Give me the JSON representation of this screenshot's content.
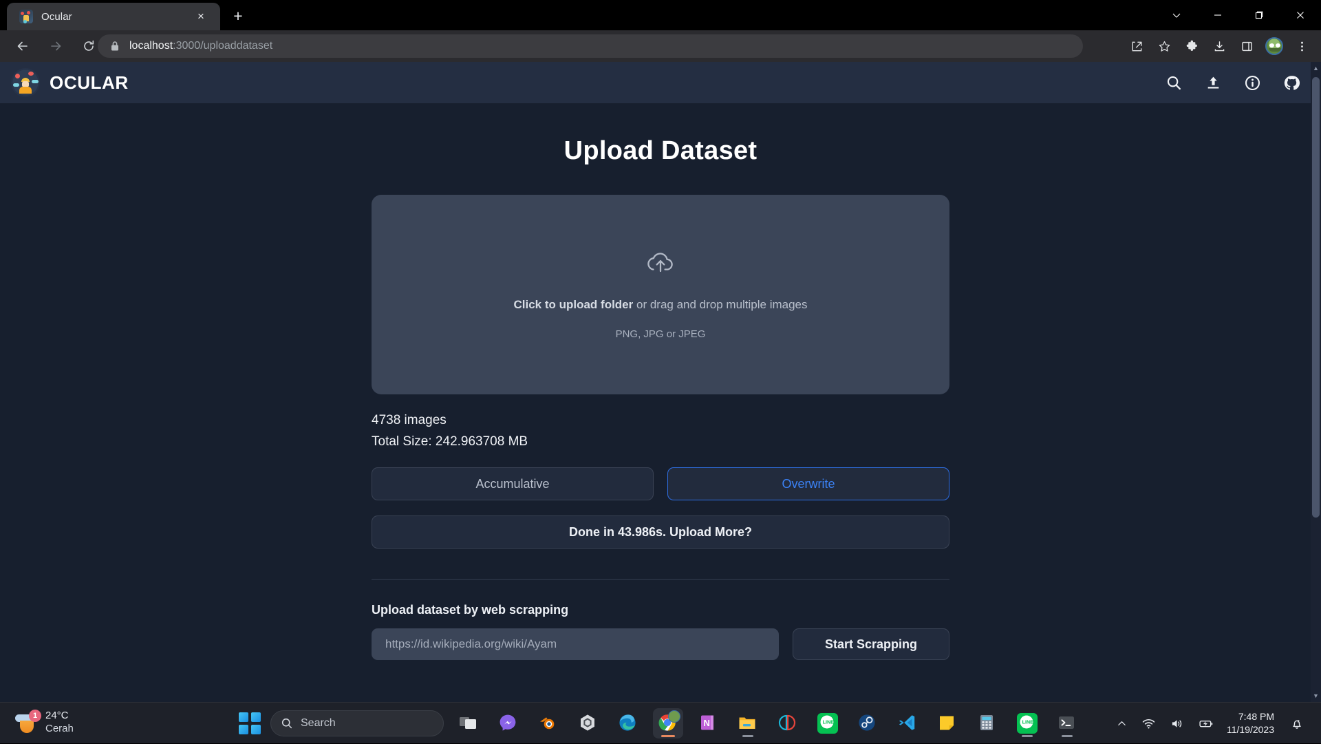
{
  "browser": {
    "tab": {
      "title": "Ocular",
      "favicon": "ocular-favicon",
      "close_label": "×"
    },
    "new_tab_label": "+",
    "window_controls": {
      "collapse": "chevron-down",
      "minimize": "minimize",
      "maximize": "restore",
      "close": "close"
    },
    "nav": {
      "back": "back-arrow",
      "forward": "forward-arrow",
      "reload": "reload"
    },
    "omnibox": {
      "lock": "lock-icon",
      "url_host": "localhost",
      "url_path": ":3000/uploaddataset",
      "url_full": "localhost:3000/uploaddataset"
    },
    "actions": [
      "share-icon",
      "bookmark-star-icon",
      "extensions-icon",
      "downloads-icon",
      "side-panel-icon",
      "profile-avatar",
      "more-menu-icon"
    ]
  },
  "app": {
    "brand": "OCULAR",
    "nav_icons": [
      "search-icon",
      "upload-icon",
      "info-icon",
      "github-icon"
    ]
  },
  "main": {
    "title": "Upload Dataset",
    "dropzone": {
      "icon": "cloud-upload-icon",
      "primary_strong": "Click to upload folder",
      "primary_rest": " or drag and drop multiple images",
      "secondary": "PNG, JPG or JPEG"
    },
    "stats": {
      "images": "4738 images",
      "total_size": "Total Size: 242.963708 MB"
    },
    "modes": [
      {
        "label": "Accumulative",
        "active": false
      },
      {
        "label": "Overwrite",
        "active": true
      }
    ],
    "done_message": "Done in 43.986s. Upload More?",
    "scraping": {
      "label": "Upload dataset by web scrapping",
      "input_value": "",
      "input_placeholder": "https://id.wikipedia.org/wiki/Ayam",
      "button": "Start Scrapping"
    }
  },
  "colors": {
    "accent_blue": "#3b82f6",
    "page_bg": "#171f2e",
    "appbar_bg": "#242e42",
    "dropzone_bg": "#3b4558",
    "button_bg": "#222b3d"
  },
  "taskbar": {
    "weather": {
      "temperature": "24°C",
      "condition": "Cerah",
      "badge": "1"
    },
    "start_label": "start-button",
    "search_placeholder": "Search",
    "apps": [
      {
        "name": "task-view",
        "running": false
      },
      {
        "name": "messenger",
        "running": false
      },
      {
        "name": "blender",
        "running": false
      },
      {
        "name": "unity",
        "running": false
      },
      {
        "name": "microsoft-edge",
        "running": false
      },
      {
        "name": "google-chrome",
        "running": true
      },
      {
        "name": "onenote",
        "running": false
      },
      {
        "name": "file-explorer",
        "running": true
      },
      {
        "name": "figma",
        "running": false
      },
      {
        "name": "line",
        "running": false
      },
      {
        "name": "steam",
        "running": false
      },
      {
        "name": "visual-studio-code",
        "running": false
      },
      {
        "name": "sticky-notes",
        "running": false
      },
      {
        "name": "calculator",
        "running": false
      },
      {
        "name": "line-2",
        "running": true
      },
      {
        "name": "terminal",
        "running": true
      }
    ],
    "tray": [
      "chevron-up-icon",
      "wifi-icon",
      "volume-icon",
      "battery-icon"
    ],
    "clock": {
      "time": "7:48 PM",
      "date": "11/19/2023"
    },
    "notification": "notification-bell-icon"
  }
}
